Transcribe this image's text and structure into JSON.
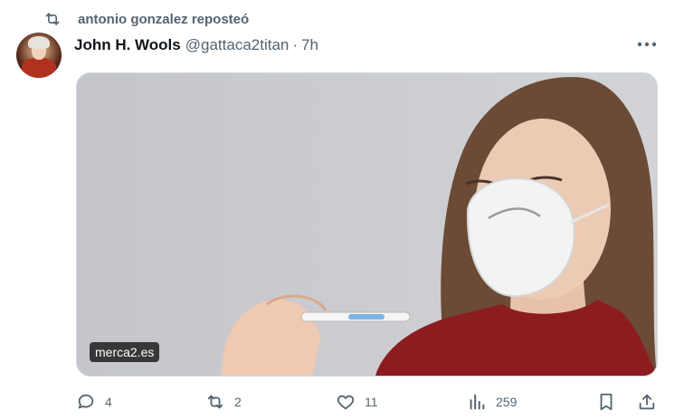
{
  "repost": {
    "text": "antonio gonzalez reposteó",
    "icon": "repost-icon"
  },
  "tweet": {
    "author_name": "John H. Wools",
    "handle": "@gattaca2titan",
    "separator": "·",
    "time": "7h",
    "media": {
      "badge": "merca2.es"
    }
  },
  "actions": {
    "replies": "4",
    "reposts": "2",
    "likes": "11",
    "views": "259"
  },
  "colors": {
    "secondary_text": "#536471",
    "icon_gray": "#536471",
    "primary_text": "#0f1419"
  }
}
